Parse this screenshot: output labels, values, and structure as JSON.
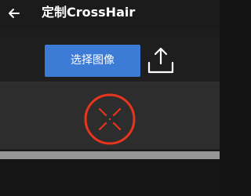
{
  "header": {
    "title": "定制CrossHair",
    "back_icon": "arrow-left-icon"
  },
  "actions": {
    "select_image_label": "选择图像",
    "upload_icon": "upload-icon"
  },
  "preview": {
    "crosshair_icon": "circle-x-crosshair-icon",
    "crosshair_color": "#e8351d"
  },
  "colors": {
    "accent_button": "#3c7bd6",
    "background": "#1c1c1c",
    "preview_background": "#2d2d2d",
    "divider": "#969696"
  }
}
